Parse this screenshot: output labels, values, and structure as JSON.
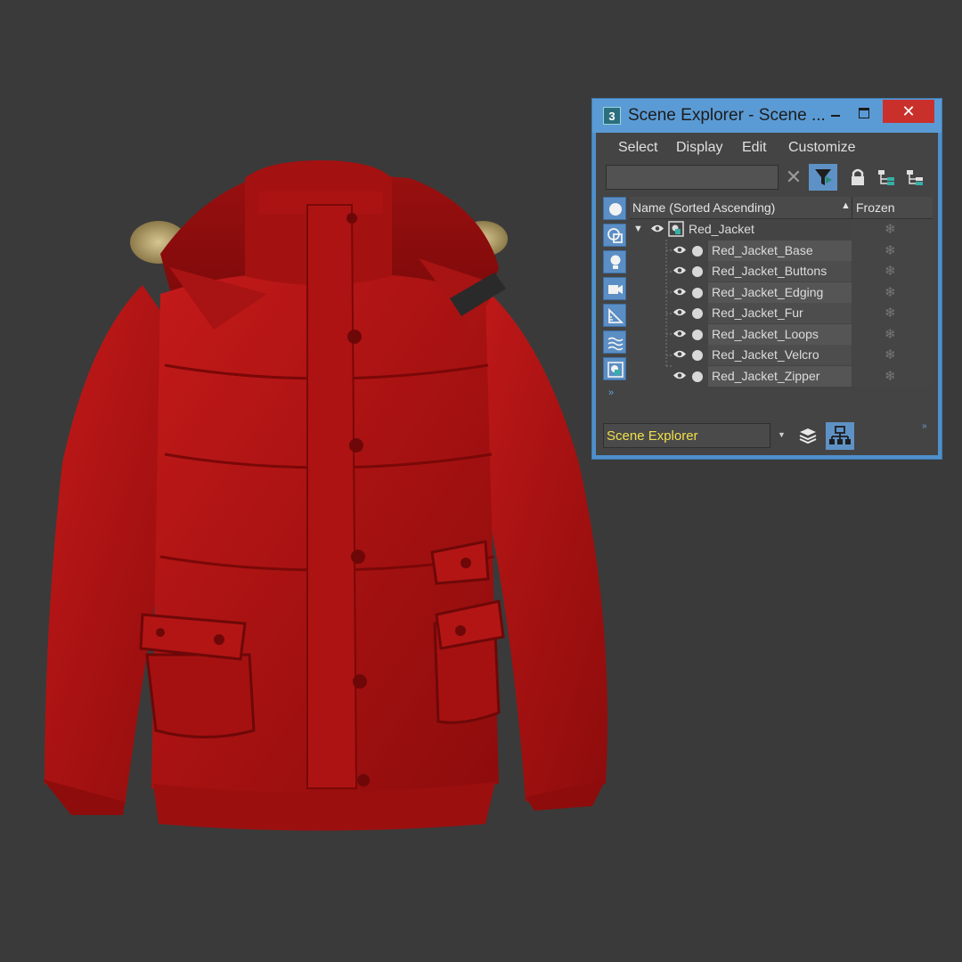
{
  "window": {
    "app_icon_text": "3",
    "title": "Scene Explorer - Scene ...",
    "close_symbol": "✕"
  },
  "menu": [
    "Select",
    "Display",
    "Edit",
    "Customize"
  ],
  "search": {
    "value": "",
    "clear_symbol": "✕"
  },
  "columns": {
    "name": "Name (Sorted Ascending)",
    "sort_indicator": "▲",
    "frozen": "Frozen"
  },
  "tree": {
    "root": "Red_Jacket",
    "children": [
      "Red_Jacket_Base",
      "Red_Jacket_Buttons",
      "Red_Jacket_Edging",
      "Red_Jacket_Fur",
      "Red_Jacket_Loops",
      "Red_Jacket_Velcro",
      "Red_Jacket_Zipper"
    ],
    "frozen_symbol": "❄"
  },
  "bottom": {
    "layer_dropdown": "Scene Explorer",
    "dropdown_arrow": "▼",
    "expand_symbol": "»"
  },
  "left_toolbar_icons": [
    "geometry-icon",
    "shapes-icon",
    "lights-icon",
    "cameras-icon",
    "helpers-icon",
    "space-warps-icon",
    "groups-icon"
  ],
  "colors": {
    "viewport_bg": "#3a3a3a",
    "jacket": "#b01414",
    "title_bar": "#5b9bd5",
    "close_button": "#c9302c",
    "panel_bg": "#444444",
    "layer_text": "#f0e04a"
  }
}
